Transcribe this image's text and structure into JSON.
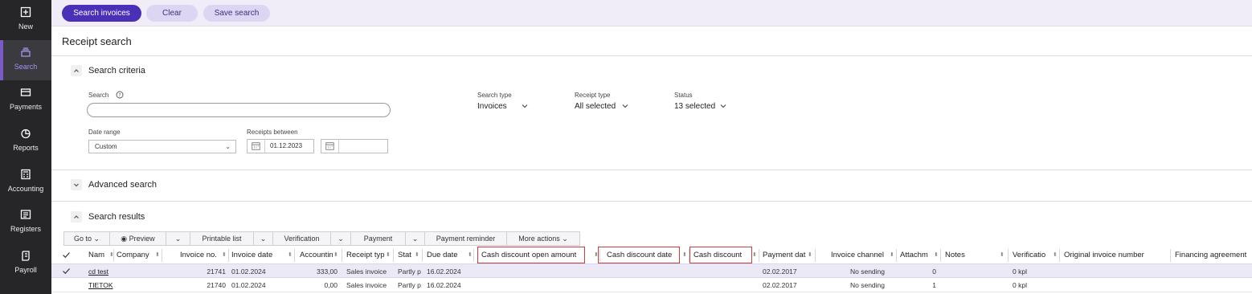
{
  "sidebar": {
    "items": [
      {
        "label": "New",
        "icon": "plus-square-icon"
      },
      {
        "label": "Search",
        "icon": "stack-icon",
        "active": true
      },
      {
        "label": "Payments",
        "icon": "card-icon"
      },
      {
        "label": "Reports",
        "icon": "pie-chart-icon"
      },
      {
        "label": "Accounting",
        "icon": "calculator-icon"
      },
      {
        "label": "Registers",
        "icon": "register-icon"
      },
      {
        "label": "Payroll",
        "icon": "payroll-icon"
      }
    ]
  },
  "toolbar": {
    "search_label": "Search invoices",
    "clear_label": "Clear",
    "save_label": "Save search"
  },
  "page": {
    "title": "Receipt search"
  },
  "criteria": {
    "title": "Search criteria",
    "search_label": "Search",
    "search_value": "",
    "search_type_label": "Search type",
    "search_type_value": "Invoices",
    "receipt_type_label": "Receipt type",
    "receipt_type_value": "All selected",
    "status_label": "Status",
    "status_value": "13 selected",
    "date_range_label": "Date range",
    "date_range_value": "Custom",
    "receipts_between_label": "Receipts between",
    "date_from": "01.12.2023",
    "date_to": ""
  },
  "advanced": {
    "title": "Advanced search"
  },
  "results": {
    "title": "Search results",
    "actions": [
      "Go to",
      "Preview",
      "Printable list",
      "Verification",
      "Payment",
      "Payment reminder",
      "More actions"
    ],
    "columns": [
      "Nam",
      "Company",
      "Invoice no.",
      "Invoice date",
      "Accountin",
      "Receipt typ",
      "Stat",
      "Due date",
      "Cash discount open amount",
      "Cash discount date",
      "Cash discount",
      "Payment dat",
      "Invoice channel",
      "Attachm",
      "Notes",
      "Verificatio",
      "Original invoice number",
      "Financing agreement"
    ],
    "rows": [
      {
        "name": "cd test",
        "company": "",
        "invoice_no": "21741",
        "invoice_date": "01.02.2024",
        "accounting": "333,00",
        "receipt_type": "Sales invoice",
        "status": "Partly p",
        "due_date": "16.02.2024",
        "cd_open": "",
        "cd_date": "",
        "cd": "",
        "payment_date": "02.02.2017",
        "channel": "No sending",
        "attachments": "0",
        "notes": "",
        "verification": "0 kpl",
        "orig": "",
        "financing": ""
      },
      {
        "name": "TIETOK",
        "company": "",
        "invoice_no": "21740",
        "invoice_date": "01.02.2024",
        "accounting": "0,00",
        "receipt_type": "Sales invoice",
        "status": "Partly p",
        "due_date": "16.02.2024",
        "cd_open": "",
        "cd_date": "",
        "cd": "",
        "payment_date": "02.02.2017",
        "channel": "No sending",
        "attachments": "1",
        "notes": "",
        "verification": "0 kpl",
        "orig": "",
        "financing": ""
      }
    ]
  }
}
